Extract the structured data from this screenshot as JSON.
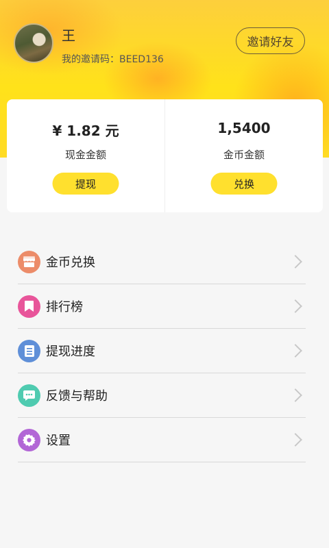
{
  "profile": {
    "name": "王",
    "invite_code": "我的邀请码：BEED136",
    "invite_button": "邀请好友"
  },
  "wallet": {
    "cash": {
      "amount": "¥ 1.82 元",
      "label": "现金金额",
      "button": "提现"
    },
    "coins": {
      "amount": "1,5400",
      "label": "金币金额",
      "button": "兑换"
    }
  },
  "menu": {
    "items": [
      {
        "label": "金币兑换",
        "icon": "shop-icon",
        "color": "#ec8c69"
      },
      {
        "label": "排行榜",
        "icon": "bookmark-icon",
        "color": "#e8559a"
      },
      {
        "label": "提现进度",
        "icon": "document-icon",
        "color": "#5f8fd8"
      },
      {
        "label": "反馈与帮助",
        "icon": "chat-icon",
        "color": "#4fcbb0"
      },
      {
        "label": "设置",
        "icon": "gear-icon",
        "color": "#b266d6"
      }
    ]
  },
  "colors": {
    "accent_yellow": "#ffe02e",
    "header_orange": "#fdcf3c"
  }
}
